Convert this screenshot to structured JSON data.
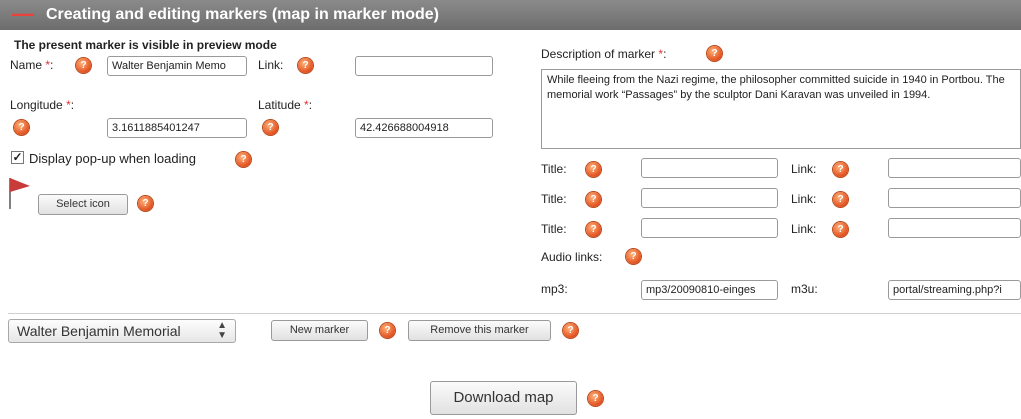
{
  "header": {
    "title": "Creating and editing markers (map in marker mode)",
    "collapse_icon": "minus-icon",
    "accent": "#e8423a"
  },
  "left": {
    "visible_note": "The present marker is visible in preview mode",
    "name_label": "Name",
    "name_value": "Walter Benjamin Memo",
    "link_label": "Link:",
    "link_value": "",
    "longitude_label": "Longitude",
    "longitude_value": "3.1611885401247",
    "latitude_label": "Latitude",
    "latitude_value": "42.426688004918",
    "popup_label": "Display pop-up when loading",
    "popup_checked": true,
    "select_icon_label": "Select icon",
    "marker_icon": "red-flag-icon"
  },
  "required_mark": "*",
  "colon": ":",
  "help_glyph": "?",
  "right": {
    "description_label": "Description of marker",
    "description_text": "While fleeing from the Nazi regime, the philosopher committed suicide in 1940 in Portbou. The memorial work “Passages” by the sculptor Dani Karavan was unveiled in 1994.",
    "title_label": "Title:",
    "link_label": "Link:",
    "rows": [
      {
        "title": "",
        "link": ""
      },
      {
        "title": "",
        "link": ""
      },
      {
        "title": "",
        "link": ""
      }
    ],
    "audio_label": "Audio links:",
    "mp3_label": "mp3:",
    "mp3_value": "mp3/20090810-einges",
    "m3u_label": "m3u:",
    "m3u_value": "portal/streaming.php?i"
  },
  "bottom": {
    "marker_select_value": "Walter Benjamin Memorial",
    "new_marker_label": "New marker",
    "remove_marker_label": "Remove this marker",
    "download_label": "Download map"
  }
}
